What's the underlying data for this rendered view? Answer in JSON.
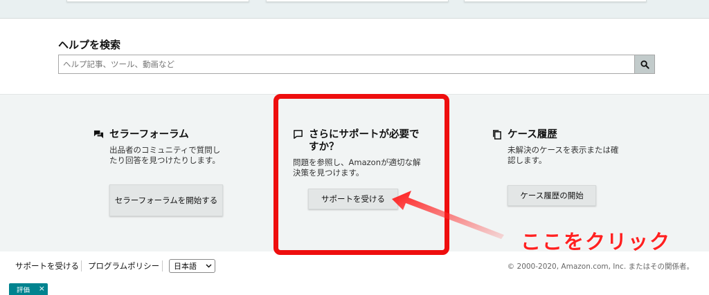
{
  "help": {
    "title": "ヘルプを検索",
    "search_placeholder": "ヘルプ記事、ツール、動画など",
    "search_icon": "search-icon"
  },
  "columns": [
    {
      "icon": "forum-icon",
      "heading": "セラーフォーラム",
      "description": "出品者のコミュニティで質問したり回答を見つけたりします。",
      "button": "セラーフォーラムを開始する"
    },
    {
      "icon": "chat-bubble-icon",
      "heading": "さらにサポートが必要ですか？",
      "description": "問題を参照し、Amazonが適切な解決策を見つけます。",
      "button": "サポートを受ける"
    },
    {
      "icon": "copy-icon",
      "heading": "ケース履歴",
      "description": "未解決のケースを表示または確認します。",
      "button": "ケース履歴の開始"
    }
  ],
  "annotation": {
    "text": "ここをクリック",
    "color": "#ff2020"
  },
  "footer": {
    "links": [
      "サポートを受ける",
      "プログラムポリシー"
    ],
    "language": "日本語",
    "copyright": "© 2000-2020, Amazon.com, Inc. またはその関係者。"
  },
  "badge": {
    "label": "評価",
    "close": "×",
    "color": "#00838f"
  }
}
